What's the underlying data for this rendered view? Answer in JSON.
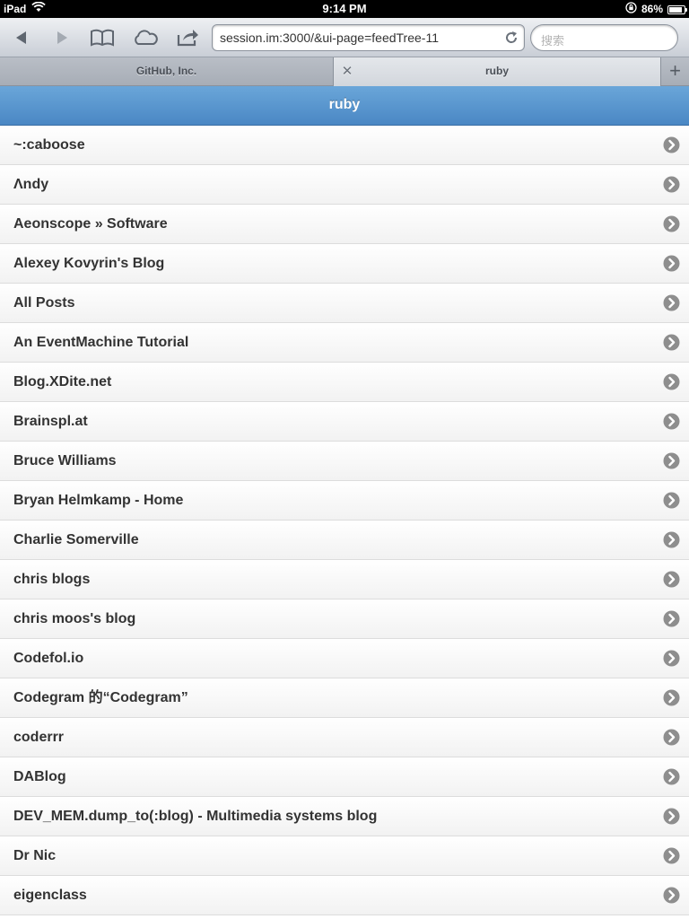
{
  "status_bar": {
    "device": "iPad",
    "time": "9:14 PM",
    "battery": "86%",
    "battery_level": 0.86
  },
  "browser": {
    "back_icon": "back-arrow-icon",
    "forward_icon": "forward-arrow-icon",
    "bookmarks_icon": "book-icon",
    "icloud_icon": "cloud-icon",
    "share_icon": "share-icon",
    "url": "session.im:3000/&ui-page=feedTree-11",
    "search_placeholder": "搜索"
  },
  "tabs": [
    {
      "title": "GitHub, Inc."
    },
    {
      "title": "ruby"
    }
  ],
  "header": {
    "title": "ruby"
  },
  "feeds": [
    {
      "label": "~:caboose"
    },
    {
      "label": "Λndy"
    },
    {
      "label": "Aeonscope » Software"
    },
    {
      "label": "Alexey Kovyrin's Blog"
    },
    {
      "label": "All Posts"
    },
    {
      "label": "An EventMachine Tutorial"
    },
    {
      "label": "Blog.XDite.net"
    },
    {
      "label": "Brainspl.at"
    },
    {
      "label": "Bruce Williams"
    },
    {
      "label": "Bryan Helmkamp - Home"
    },
    {
      "label": "Charlie Somerville"
    },
    {
      "label": "chris blogs"
    },
    {
      "label": "chris moos's blog"
    },
    {
      "label": "Codefol.io"
    },
    {
      "label": "Codegram 的“Codegram”"
    },
    {
      "label": "coderrr"
    },
    {
      "label": "DABlog"
    },
    {
      "label": "DEV_MEM.dump_to(:blog) - Multimedia systems blog"
    },
    {
      "label": "Dr Nic"
    },
    {
      "label": "eigenclass"
    }
  ],
  "colors": {
    "header_blue": "#4a87c4",
    "arrow_grey": "#8e8e8e"
  }
}
